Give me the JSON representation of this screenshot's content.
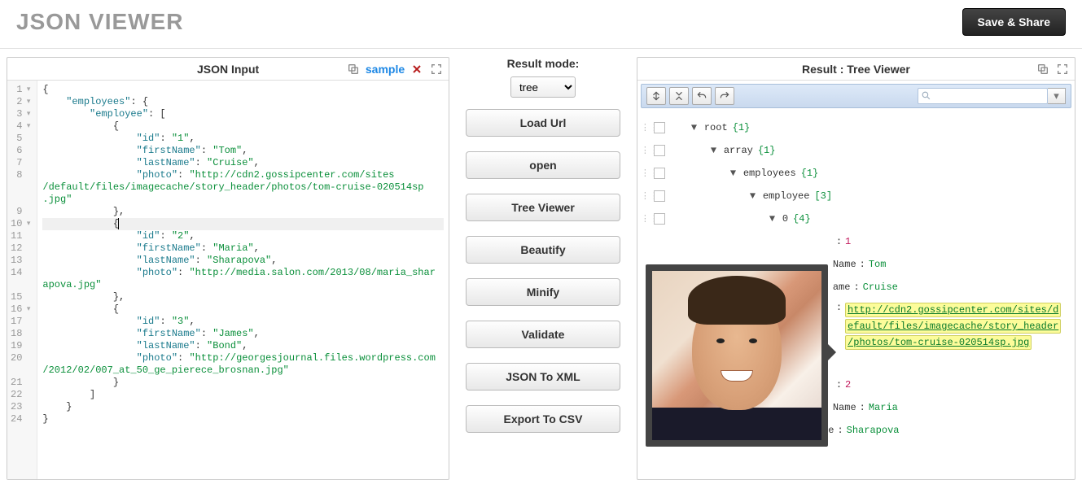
{
  "header": {
    "title": "JSON VIEWER",
    "save_share": "Save & Share"
  },
  "left": {
    "title": "JSON Input",
    "sample": "sample",
    "lines": [
      {
        "n": "1",
        "fold": true,
        "html": "<span class='tk-pun'>{</span>"
      },
      {
        "n": "2",
        "fold": true,
        "html": "    <span class='tk-key'>\"employees\"</span><span class='tk-pun'>: {</span>"
      },
      {
        "n": "3",
        "fold": true,
        "html": "        <span class='tk-key'>\"employee\"</span><span class='tk-pun'>: [</span>"
      },
      {
        "n": "4",
        "fold": true,
        "html": "            <span class='tk-pun'>{</span>"
      },
      {
        "n": "5",
        "html": "                <span class='tk-key'>\"id\"</span><span class='tk-pun'>: </span><span class='tk-str'>\"1\"</span><span class='tk-pun'>,</span>"
      },
      {
        "n": "6",
        "html": "                <span class='tk-key'>\"firstName\"</span><span class='tk-pun'>: </span><span class='tk-str'>\"Tom\"</span><span class='tk-pun'>,</span>"
      },
      {
        "n": "7",
        "html": "                <span class='tk-key'>\"lastName\"</span><span class='tk-pun'>: </span><span class='tk-str'>\"Cruise\"</span><span class='tk-pun'>,</span>"
      },
      {
        "n": "8",
        "html": "                <span class='tk-key'>\"photo\"</span><span class='tk-pun'>: </span><span class='tk-str'>\"http://cdn2.gossipcenter.com/sites</span>"
      },
      {
        "n": "",
        "html": "<span class='tk-str'>/default/files/imagecache/story_header/photos/tom-cruise-020514sp</span>"
      },
      {
        "n": "",
        "html": "<span class='tk-str'>.jpg\"</span>"
      },
      {
        "n": "9",
        "html": "            <span class='tk-pun'>},</span>"
      },
      {
        "n": "10",
        "fold": true,
        "hl": true,
        "html": "            <span class='tk-pun'>{</span><span style='border-left:1px solid #000;margin-left:-1px'></span>"
      },
      {
        "n": "11",
        "html": "                <span class='tk-key'>\"id\"</span><span class='tk-pun'>: </span><span class='tk-str'>\"2\"</span><span class='tk-pun'>,</span>"
      },
      {
        "n": "12",
        "html": "                <span class='tk-key'>\"firstName\"</span><span class='tk-pun'>: </span><span class='tk-str'>\"Maria\"</span><span class='tk-pun'>,</span>"
      },
      {
        "n": "13",
        "html": "                <span class='tk-key'>\"lastName\"</span><span class='tk-pun'>: </span><span class='tk-str'>\"Sharapova\"</span><span class='tk-pun'>,</span>"
      },
      {
        "n": "14",
        "html": "                <span class='tk-key'>\"photo\"</span><span class='tk-pun'>: </span><span class='tk-str'>\"http://media.salon.com/2013/08/maria_shar</span>"
      },
      {
        "n": "",
        "html": "<span class='tk-str'>apova.jpg\"</span>"
      },
      {
        "n": "15",
        "html": "            <span class='tk-pun'>},</span>"
      },
      {
        "n": "16",
        "fold": true,
        "html": "            <span class='tk-pun'>{</span>"
      },
      {
        "n": "17",
        "html": "                <span class='tk-key'>\"id\"</span><span class='tk-pun'>: </span><span class='tk-str'>\"3\"</span><span class='tk-pun'>,</span>"
      },
      {
        "n": "18",
        "html": "                <span class='tk-key'>\"firstName\"</span><span class='tk-pun'>: </span><span class='tk-str'>\"James\"</span><span class='tk-pun'>,</span>"
      },
      {
        "n": "19",
        "html": "                <span class='tk-key'>\"lastName\"</span><span class='tk-pun'>: </span><span class='tk-str'>\"Bond\"</span><span class='tk-pun'>,</span>"
      },
      {
        "n": "20",
        "html": "                <span class='tk-key'>\"photo\"</span><span class='tk-pun'>: </span><span class='tk-str'>\"http://georgesjournal.files.wordpress.com</span>"
      },
      {
        "n": "",
        "html": "<span class='tk-str'>/2012/02/007_at_50_ge_pierece_brosnan.jpg\"</span>"
      },
      {
        "n": "21",
        "html": "            <span class='tk-pun'>}</span>"
      },
      {
        "n": "22",
        "html": "        <span class='tk-pun'>]</span>"
      },
      {
        "n": "23",
        "html": "    <span class='tk-pun'>}</span>"
      },
      {
        "n": "24",
        "html": "<span class='tk-pun'>}</span>"
      }
    ]
  },
  "mid": {
    "title": "Result mode:",
    "mode": "tree",
    "buttons": [
      "Load Url",
      "open",
      "Tree Viewer",
      "Beautify",
      "Minify",
      "Validate",
      "JSON To XML",
      "Export To CSV"
    ]
  },
  "right": {
    "title": "Result : Tree Viewer",
    "tree": {
      "root": {
        "label": "root",
        "meta": "{1}"
      },
      "array": {
        "label": "array",
        "meta": "{1}"
      },
      "employees": {
        "label": "employees",
        "meta": "{1}"
      },
      "employee": {
        "label": "employee",
        "meta": "[3]"
      },
      "idx0": {
        "label": "0",
        "meta": "{4}"
      },
      "id1": {
        "value": "1"
      },
      "fn1": {
        "key": "Name",
        "value": "Tom"
      },
      "ln1": {
        "key": "ame",
        "value": "Cruise"
      },
      "photo1_lines": [
        "http://cdn2.gossipcenter.com/sites/d",
        "efault/files/imagecache/story_header",
        "/photos/tom-cruise-020514sp.jpg"
      ],
      "id2": {
        "value": "2"
      },
      "fn2": {
        "key": "Name",
        "value": "Maria"
      },
      "ln2": {
        "key": "lastName",
        "value": "Sharapova"
      }
    }
  }
}
